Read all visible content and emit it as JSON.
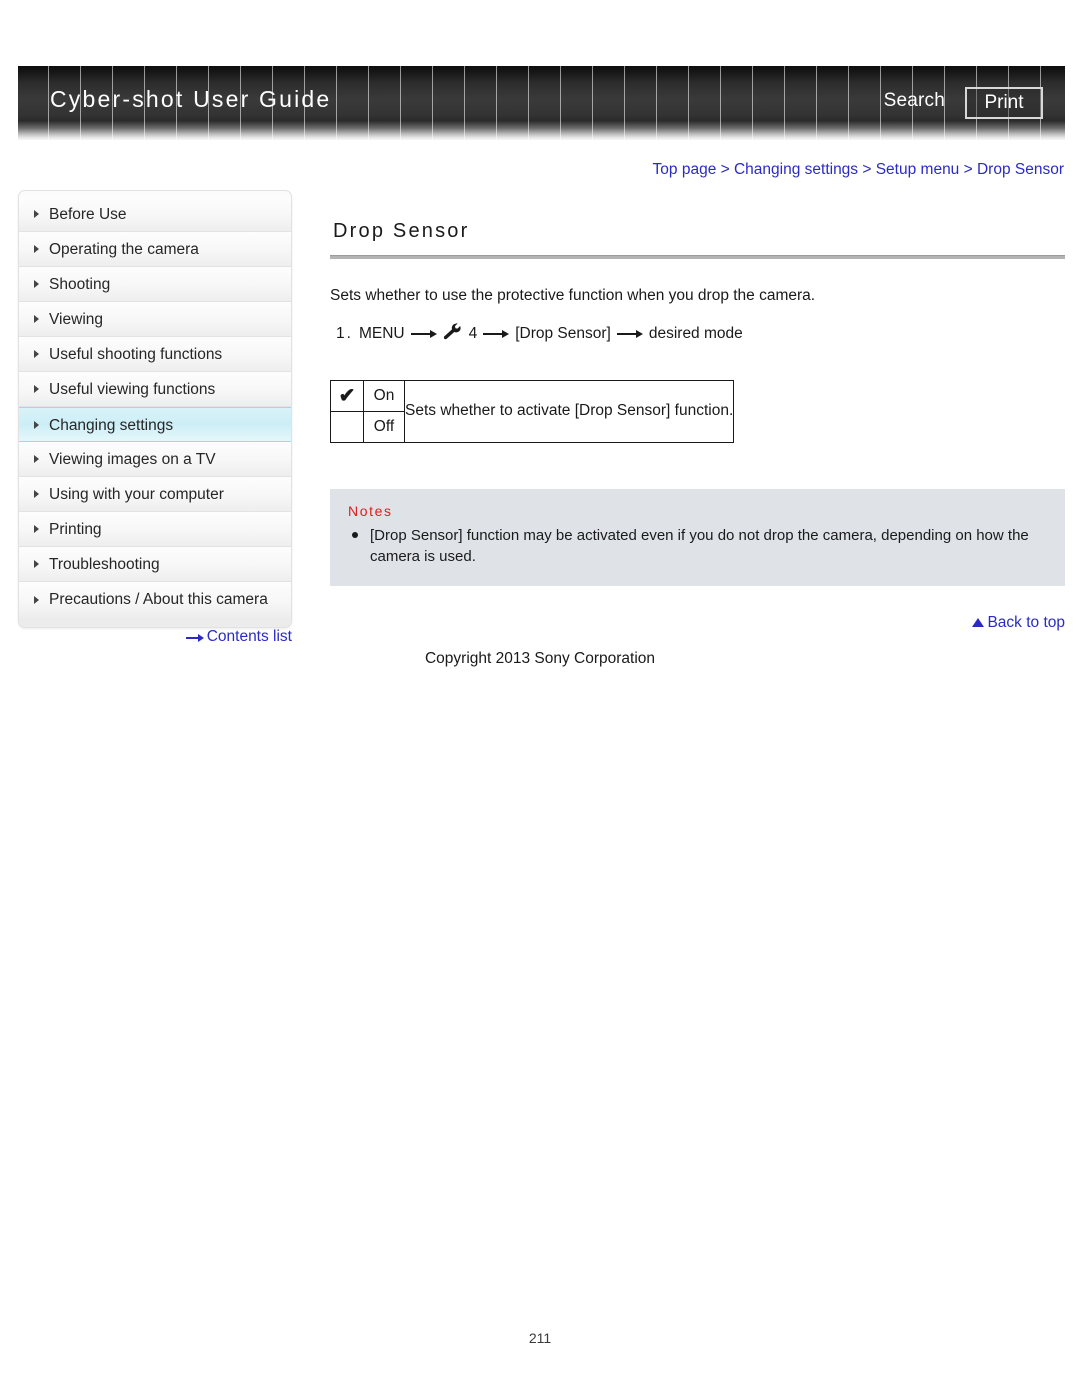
{
  "header": {
    "title": "Cyber-shot User Guide",
    "search_label": "Search",
    "print_label": "Print"
  },
  "breadcrumb": {
    "text": "Top page > Changing settings > Setup menu > Drop Sensor",
    "link_color": "#2b2bc4"
  },
  "sidebar": {
    "items": [
      {
        "label": "Before Use",
        "active": false
      },
      {
        "label": "Operating the camera",
        "active": false
      },
      {
        "label": "Shooting",
        "active": false
      },
      {
        "label": "Viewing",
        "active": false
      },
      {
        "label": "Useful shooting functions",
        "active": false
      },
      {
        "label": "Useful viewing functions",
        "active": false
      },
      {
        "label": "Changing settings",
        "active": true
      },
      {
        "label": "Viewing images on a TV",
        "active": false
      },
      {
        "label": "Using with your computer",
        "active": false
      },
      {
        "label": "Printing",
        "active": false
      },
      {
        "label": "Troubleshooting",
        "active": false
      },
      {
        "label": "Precautions / About this camera",
        "active": false
      }
    ],
    "contents_list_label": "Contents list",
    "active_highlight_color": "#cdeef6"
  },
  "main": {
    "title": "Drop Sensor",
    "intro": "Sets whether to use the protective function when you drop the camera.",
    "step": {
      "number": "1.",
      "menu_label": "MENU",
      "tab_number": "4",
      "bracket_item": "[Drop Sensor]",
      "result": "desired mode",
      "wrench_icon_name": "wrench-icon"
    },
    "option_table": {
      "rows": [
        {
          "check": "✔",
          "mode": "On"
        },
        {
          "check": "",
          "mode": "Off"
        }
      ],
      "description": "Sets whether to activate [Drop Sensor] function."
    },
    "notes": {
      "title": "Notes",
      "title_color": "#e01b1b",
      "background_color": "#dfe3e8",
      "items": [
        "[Drop Sensor] function may be activated even if you do not drop the camera, depending on how the camera is used."
      ]
    },
    "back_to_top_label": "Back to top"
  },
  "footer": {
    "copyright": "Copyright 2013 Sony Corporation",
    "page_number": "211"
  }
}
